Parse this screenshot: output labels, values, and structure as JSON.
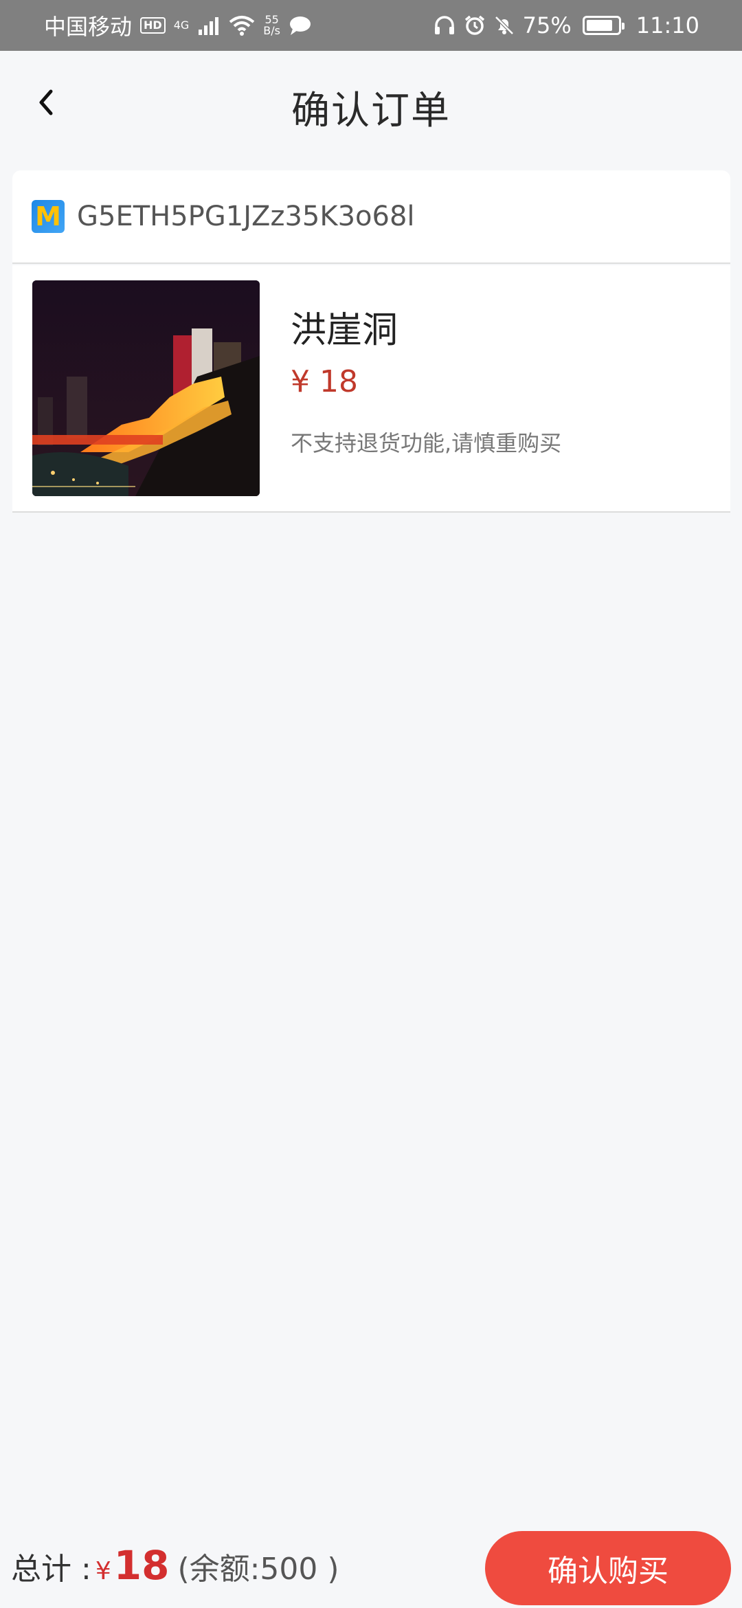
{
  "status_bar": {
    "carrier": "中国移动",
    "hd": "HD",
    "network": "4G",
    "speed_value": "55",
    "speed_unit": "B/s",
    "battery": "75%",
    "time": "11:10"
  },
  "header": {
    "title": "确认订单"
  },
  "shop": {
    "logo_letter": "M",
    "name": "G5ETH5PG1JZz35K3o68l"
  },
  "item": {
    "name": "洪崖洞",
    "price": "¥ 18",
    "note": "不支持退货功能,请慎重购买"
  },
  "footer": {
    "total_label": "总计 :",
    "currency": "¥",
    "total_amount": "18",
    "balance": "(余额:500 )",
    "confirm_label": "确认购买"
  },
  "colors": {
    "accent": "#ef4b3f",
    "price": "#d32f2f",
    "status_bar": "#808080"
  }
}
